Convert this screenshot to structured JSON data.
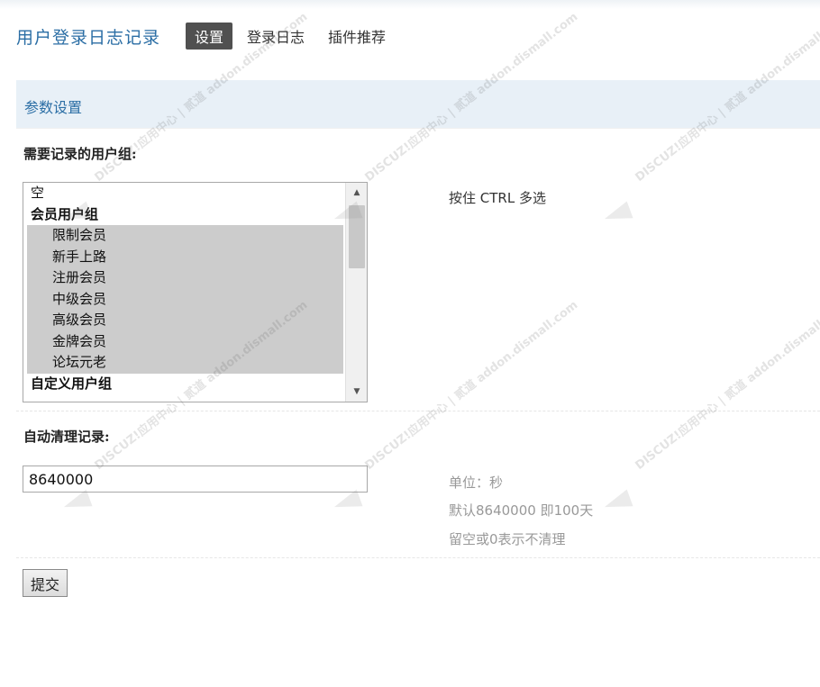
{
  "header": {
    "app_title": "用户登录日志记录",
    "tabs": [
      {
        "label": "设置",
        "active": true
      },
      {
        "label": "登录日志",
        "active": false
      },
      {
        "label": "插件推荐",
        "active": false
      }
    ]
  },
  "section": {
    "title": "参数设置"
  },
  "user_groups": {
    "label": "需要记录的用户组:",
    "hint": "按住 CTRL 多选",
    "options": [
      {
        "label": "空",
        "type": "plain",
        "selected": false
      },
      {
        "label": "会员用户组",
        "type": "group",
        "selected": false
      },
      {
        "label": "限制会员",
        "type": "opt",
        "selected": true
      },
      {
        "label": "新手上路",
        "type": "opt",
        "selected": true
      },
      {
        "label": "注册会员",
        "type": "opt",
        "selected": true
      },
      {
        "label": "中级会员",
        "type": "opt",
        "selected": true
      },
      {
        "label": "高级会员",
        "type": "opt",
        "selected": true
      },
      {
        "label": "金牌会员",
        "type": "opt",
        "selected": true
      },
      {
        "label": "论坛元老",
        "type": "opt",
        "selected": true
      },
      {
        "label": "自定义用户组",
        "type": "group",
        "selected": false
      }
    ]
  },
  "auto_clean": {
    "label": "自动清理记录:",
    "value": "8640000",
    "hint_unit": "单位：秒",
    "hint_default": "默认8640000 即100天",
    "hint_empty": "留空或0表示不清理"
  },
  "submit_label": "提交",
  "watermark": {
    "text": "DISCUZ!应用中心 | 贰道 addon.dismall.com"
  },
  "colors": {
    "accent": "#2b6ea5",
    "section_bg": "#e8f0f7",
    "tab_active_bg": "#505050",
    "selected_bg": "#cccccc"
  }
}
